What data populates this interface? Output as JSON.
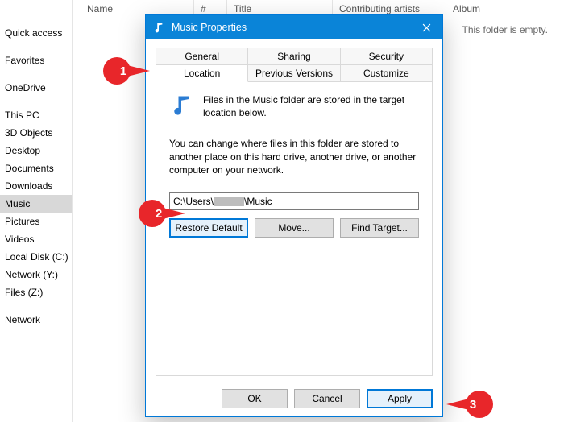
{
  "explorer": {
    "columns": {
      "name": "Name",
      "num": "#",
      "title": "Title",
      "contrib": "Contributing artists",
      "album": "Album"
    },
    "empty_msg": "This folder is empty.",
    "sidebar": [
      {
        "label": "Quick access"
      },
      {
        "label": "Favorites"
      },
      {
        "label": "OneDrive"
      },
      {
        "label": "This PC"
      },
      {
        "label": "3D Objects"
      },
      {
        "label": "Desktop"
      },
      {
        "label": "Documents"
      },
      {
        "label": "Downloads"
      },
      {
        "label": "Music",
        "selected": true
      },
      {
        "label": "Pictures"
      },
      {
        "label": "Videos"
      },
      {
        "label": "Local Disk (C:)"
      },
      {
        "label": "Network (Y:)"
      },
      {
        "label": "Files (Z:)"
      },
      {
        "label": "Network"
      }
    ]
  },
  "dialog": {
    "title": "Music Properties",
    "tabs_row1": {
      "general": "General",
      "sharing": "Sharing",
      "security": "Security"
    },
    "tabs_row2": {
      "location": "Location",
      "previous": "Previous Versions",
      "customize": "Customize"
    },
    "desc1": "Files in the Music folder are stored in the target location below.",
    "desc2": "You can change where files in this folder are stored to another place on this hard drive, another drive, or another computer on your network.",
    "path_prefix": "C:\\Users\\",
    "path_suffix": "\\Music",
    "buttons": {
      "restore": "Restore Default",
      "move": "Move...",
      "find": "Find Target..."
    },
    "footer": {
      "ok": "OK",
      "cancel": "Cancel",
      "apply": "Apply"
    }
  },
  "callouts": {
    "one": "1",
    "two": "2",
    "three": "3"
  }
}
